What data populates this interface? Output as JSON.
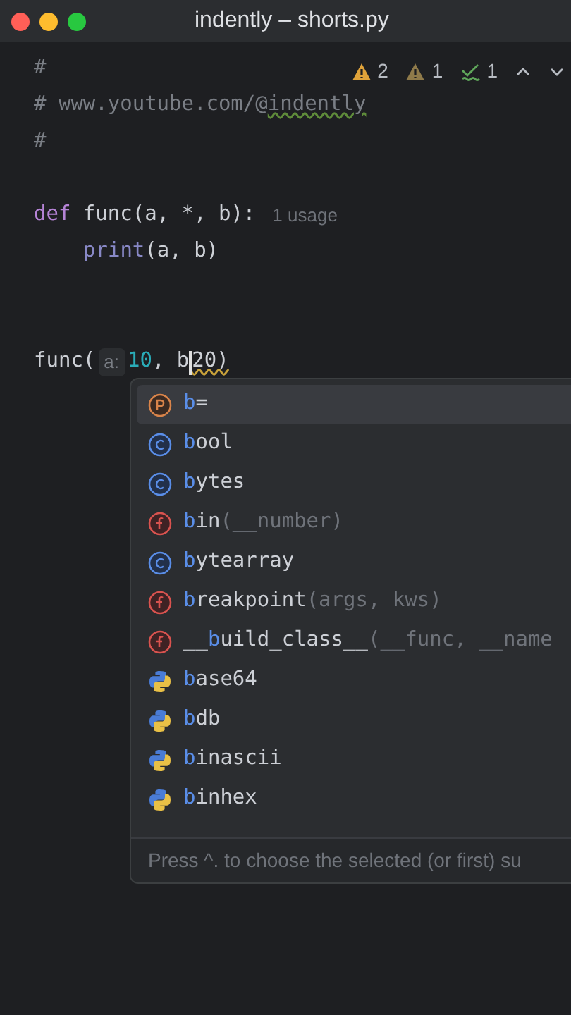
{
  "window": {
    "title": "indently – shorts.py"
  },
  "inspections": [
    {
      "kind": "warning",
      "count": "2"
    },
    {
      "kind": "weak-warning",
      "count": "1"
    },
    {
      "kind": "typo",
      "count": "1"
    }
  ],
  "code_lines": [
    {
      "kind": "code",
      "indented": false,
      "tokens": [
        {
          "kind": "comment",
          "text": "#"
        }
      ]
    },
    {
      "kind": "code",
      "indented": false,
      "tokens": [
        {
          "kind": "comment",
          "text": "# www.youtube.com/@"
        },
        {
          "kind": "comment-typo",
          "text": "indently"
        }
      ]
    },
    {
      "kind": "code",
      "indented": false,
      "tokens": [
        {
          "kind": "comment",
          "text": "#"
        }
      ]
    },
    {
      "kind": "blank"
    },
    {
      "kind": "code",
      "indented": false,
      "tokens": [
        {
          "kind": "keyword",
          "text": "def"
        },
        {
          "kind": "plain",
          "text": " func(a, *, b):"
        },
        {
          "kind": "hint",
          "text": "1 usage"
        }
      ]
    },
    {
      "kind": "code",
      "indented": true,
      "tokens": [
        {
          "kind": "builtin",
          "text": "print"
        },
        {
          "kind": "plain",
          "text": "(a, b)"
        }
      ]
    },
    {
      "kind": "blank"
    },
    {
      "kind": "blank"
    },
    {
      "kind": "code",
      "indented": false,
      "tokens": [
        {
          "kind": "plain",
          "text": "func("
        },
        {
          "kind": "param-hint",
          "text": "a:"
        },
        {
          "kind": "number",
          "text": "10"
        },
        {
          "kind": "plain",
          "text": ", b"
        },
        {
          "kind": "caret"
        },
        {
          "kind": "error",
          "text": "20)"
        }
      ]
    }
  ],
  "completion": {
    "items": [
      {
        "kind": "parameter",
        "match": "b",
        "after": "=",
        "selected": true
      },
      {
        "kind": "class",
        "match": "b",
        "after": "ool",
        "selected": false
      },
      {
        "kind": "class",
        "match": "b",
        "after": "ytes",
        "selected": false
      },
      {
        "kind": "function",
        "match": "b",
        "after": "in",
        "signature": "(__number)",
        "selected": false
      },
      {
        "kind": "class",
        "match": "b",
        "after": "ytearray",
        "selected": false
      },
      {
        "kind": "function",
        "match": "b",
        "after": "reakpoint",
        "signature": "(args, kws)",
        "selected": false
      },
      {
        "kind": "function",
        "before": "__",
        "match": "b",
        "after": "uild_class__",
        "signature": "(__func, __name",
        "selected": false
      },
      {
        "kind": "module",
        "match": "b",
        "after": "ase64",
        "selected": false
      },
      {
        "kind": "module",
        "match": "b",
        "after": "db",
        "selected": false
      },
      {
        "kind": "module",
        "match": "b",
        "after": "inascii",
        "selected": false
      },
      {
        "kind": "module",
        "match": "b",
        "after": "inhex",
        "selected": false
      }
    ],
    "footer": "Press ^. to choose the selected (or first) su"
  }
}
